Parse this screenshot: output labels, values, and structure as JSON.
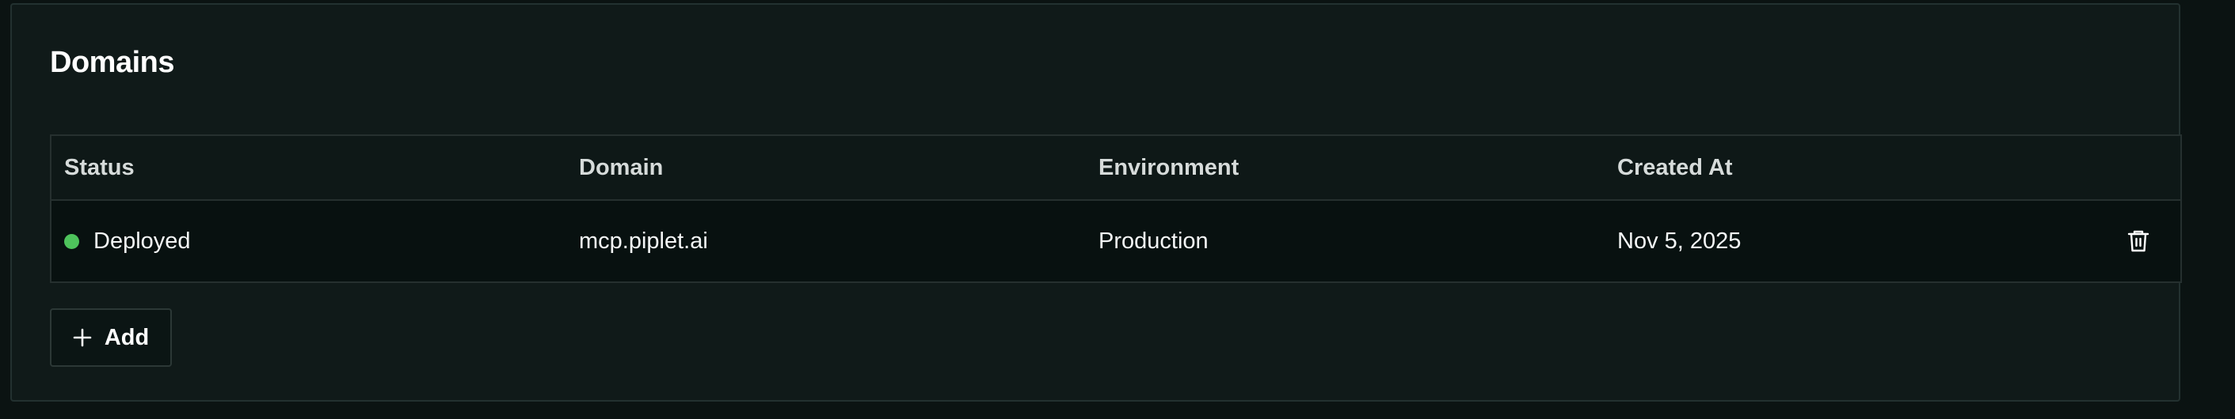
{
  "section": {
    "title": "Domains"
  },
  "table": {
    "columns": [
      "Status",
      "Domain",
      "Environment",
      "Created At"
    ],
    "rows": [
      {
        "status": "Deployed",
        "status_color": "#4ec35c",
        "domain": "mcp.piplet.ai",
        "environment": "Production",
        "created_at": "Nov 5, 2025",
        "action_icon": "trash-icon"
      }
    ]
  },
  "actions": {
    "add_label": "Add",
    "add_icon": "plus-icon"
  }
}
